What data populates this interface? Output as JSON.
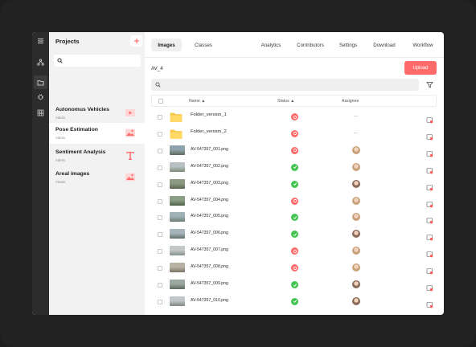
{
  "sidebar": {
    "title": "Projects",
    "search_placeholder": "",
    "projects": [
      {
        "name": "Autonomus Vehicles",
        "role": "Admin",
        "icon": "video-icon"
      },
      {
        "name": "Pose Estimation",
        "role": "Admin",
        "icon": "image-icon"
      },
      {
        "name": "Sentiment Analysis",
        "role": "Admin",
        "icon": "text-icon"
      },
      {
        "name": "Areal images",
        "role": "Viewer",
        "icon": "image-icon"
      }
    ]
  },
  "tabs": [
    "Images",
    "Classes",
    "Analytics",
    "Contributors",
    "Settings",
    "Download",
    "Workflow"
  ],
  "breadcrumb": "AV_4",
  "upload_label": "Upload",
  "search_placeholder": "",
  "table": {
    "headers": {
      "name": "Name",
      "status": "Status",
      "assignee": "Assignee"
    },
    "folders": [
      {
        "name": "Folder_version_1",
        "status": "rejected"
      },
      {
        "name": "Folder_version_2",
        "status": "rejected"
      }
    ],
    "files": [
      {
        "name": "AV-547357_001.png",
        "status": "rejected",
        "avatar_color": "#c9a27b"
      },
      {
        "name": "AV-547357_002.png",
        "status": "approved",
        "avatar_color": "#c9a27b"
      },
      {
        "name": "AV-547357_003.png",
        "status": "approved",
        "avatar_color": "#8a6a58"
      },
      {
        "name": "AV-547357_004.png",
        "status": "rejected",
        "avatar_color": "#c9a27b"
      },
      {
        "name": "AV-547357_005.png",
        "status": "approved",
        "avatar_color": "#c9a27b"
      },
      {
        "name": "AV-547357_006.png",
        "status": "approved",
        "avatar_color": "#8a6a58"
      },
      {
        "name": "AV-547357_007.png",
        "status": "rejected",
        "avatar_color": "#c9a27b"
      },
      {
        "name": "AV-547357_008.png",
        "status": "rejected",
        "avatar_color": "#c9a27b"
      },
      {
        "name": "AV-547357_009.png",
        "status": "approved",
        "avatar_color": "#8a6a58"
      },
      {
        "name": "AV-547357_010.png",
        "status": "approved",
        "avatar_color": "#8a6a58"
      }
    ]
  },
  "colors": {
    "accent": "#ff6b6b",
    "approved": "#44c552",
    "rejected": "#ff6b6b"
  }
}
